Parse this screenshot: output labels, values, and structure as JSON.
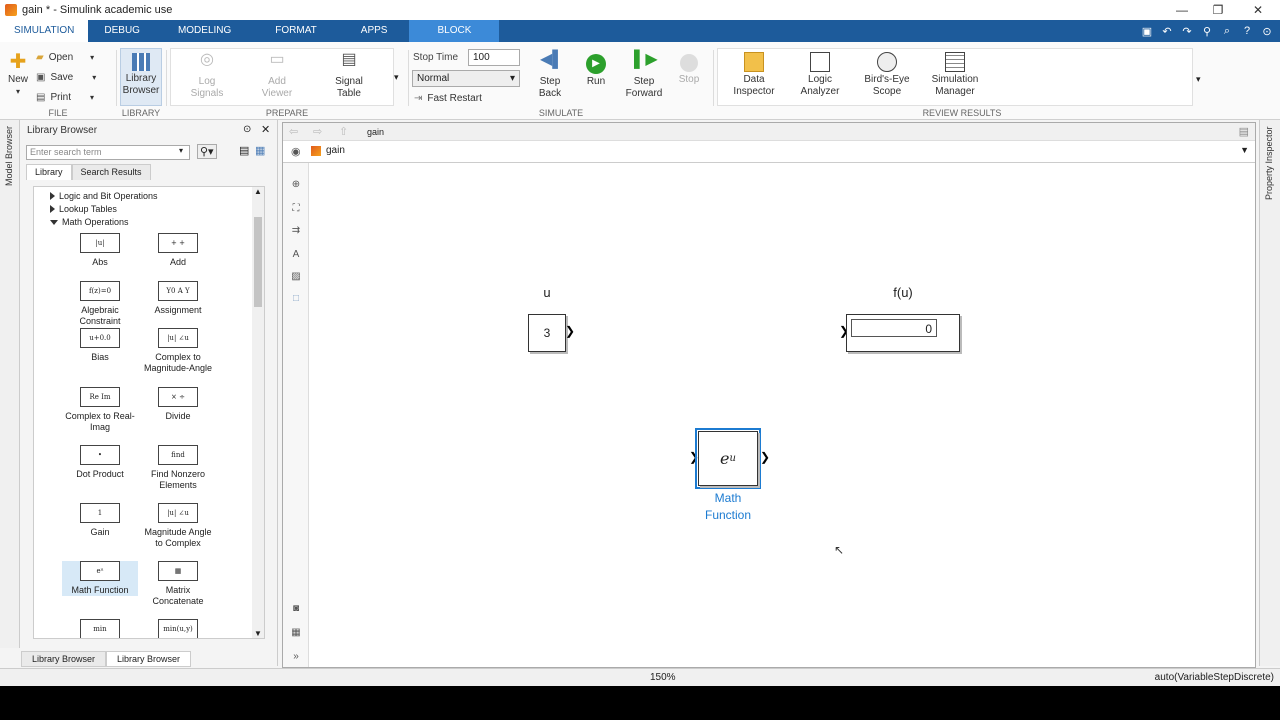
{
  "window": {
    "title": "gain * - Simulink academic use",
    "controls": [
      "—",
      "❐",
      "✕"
    ]
  },
  "tabs": [
    "SIMULATION",
    "DEBUG",
    "MODELING",
    "FORMAT",
    "APPS",
    "BLOCK"
  ],
  "ribbon": {
    "file": {
      "group_label": "FILE",
      "new": "New",
      "open": "Open",
      "save": "Save",
      "print": "Print"
    },
    "library": {
      "group_label": "LIBRARY",
      "library_browser": "Library Browser"
    },
    "prepare": {
      "group_label": "PREPARE",
      "log_signals": "Log Signals",
      "add_viewer": "Add Viewer",
      "signal_table": "Signal Table"
    },
    "simulate": {
      "group_label": "SIMULATE",
      "stop_time_label": "Stop Time",
      "stop_time_value": "100",
      "mode_value": "Normal",
      "fast_restart": "Fast Restart",
      "step_back": "Step Back",
      "run": "Run",
      "step_forward": "Step Forward",
      "stop": "Stop"
    },
    "review": {
      "group_label": "REVIEW RESULTS",
      "data_inspector": "Data Inspector",
      "logic_analyzer": "Logic Analyzer",
      "birds_eye": "Bird's-Eye Scope",
      "sim_manager": "Simulation Manager"
    }
  },
  "side": {
    "model_browser": "Model Browser",
    "property_inspector": "Property Inspector"
  },
  "library_browser": {
    "title": "Library Browser",
    "search_placeholder": "Enter search term",
    "tabs": [
      "Library",
      "Search Results"
    ],
    "tree": [
      {
        "label": "Logic and Bit Operations",
        "open": false
      },
      {
        "label": "Lookup Tables",
        "open": false
      },
      {
        "label": "Math Operations",
        "open": true
      }
    ],
    "blocks": [
      {
        "label": "Abs",
        "glyph": "|u|"
      },
      {
        "label": "Add",
        "glyph": "+ +"
      },
      {
        "label": "Algebraic Constraint",
        "glyph": "f(z)=0"
      },
      {
        "label": "Assignment",
        "glyph": "Y0 A Y"
      },
      {
        "label": "Bias",
        "glyph": "u+0.0"
      },
      {
        "label": "Complex to Magnitude-Angle",
        "glyph": "|u| ∠u"
      },
      {
        "label": "Complex to Real-Imag",
        "glyph": "Re Im"
      },
      {
        "label": "Divide",
        "glyph": "× ÷"
      },
      {
        "label": "Dot Product",
        "glyph": "•"
      },
      {
        "label": "Find Nonzero Elements",
        "glyph": "find"
      },
      {
        "label": "Gain",
        "glyph": "1"
      },
      {
        "label": "Magnitude Angle to Complex",
        "glyph": "|u| ∠u"
      },
      {
        "label": "Math Function",
        "glyph": "eᵘ"
      },
      {
        "label": "Matrix Concatenate",
        "glyph": "▦"
      },
      {
        "label": "",
        "glyph": "min"
      },
      {
        "label": "",
        "glyph": "min(u,y)"
      }
    ],
    "bottom_tabs": [
      "Library Browser",
      "Library Browser"
    ]
  },
  "canvas": {
    "tab": "gain",
    "breadcrumb": "gain",
    "blocks": {
      "constant": {
        "name": "u",
        "value": "3"
      },
      "display": {
        "name": "f(u)",
        "value": "0"
      },
      "math": {
        "label_line1": "Math",
        "label_line2": "Function",
        "expr_base": "e",
        "expr_sup": "u"
      }
    }
  },
  "status": {
    "zoom": "150%",
    "solver": "auto(VariableStepDiscrete)"
  },
  "colors": {
    "tab_bar": "#1d5b9b",
    "selection": "#1c7bd1",
    "run_green": "#2ca02c"
  }
}
